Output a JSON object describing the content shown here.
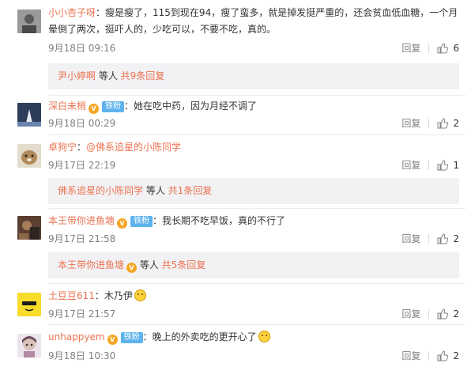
{
  "comments": [
    {
      "username": "小小杏子呀",
      "text": "瘦是瘦了，115到现在94，瘦了蛮多，就是掉发挺严重的，还会贫血低血糖，一个月晕倒了两次，挺吓人的，少吃可以，不要不吃，真的。",
      "date": "9月18日 09:16",
      "reply_label": "回复",
      "likes": "6",
      "avatar_color": "#8a8a8a",
      "sub": {
        "name": "尹小婷啊",
        "mid": " 等人 ",
        "count": "共9条回复"
      }
    },
    {
      "username": "深白未梢",
      "fan_badge": "铁粉",
      "text": "她在吃中药，因为月经不调了",
      "date": "9月18日 00:29",
      "reply_label": "回复",
      "likes": "2",
      "avatar_color": "#3a4a6a"
    },
    {
      "username": "卓狗宁",
      "mention": "@佛系追星的小陈同学",
      "date": "9月17日 22:19",
      "reply_label": "回复",
      "likes": "1",
      "avatar_color": "#c9b08a",
      "sub": {
        "name": "佛系追星的小陈同学",
        "mid": " 等人 ",
        "count": "共1条回复"
      }
    },
    {
      "username": "本王带你进鱼塘",
      "fan_badge": "铁粉",
      "text": "我长期不吃早饭，真的不行了",
      "date": "9月17日 21:58",
      "reply_label": "回复",
      "likes": "2",
      "avatar_color": "#6b4a3a",
      "sub": {
        "name": "本王带你进鱼塘",
        "mid": " 等人 ",
        "count": "共5条回复"
      }
    },
    {
      "username": "土豆豆611",
      "text": "木乃伊",
      "date": "9月17日 21:57",
      "reply_label": "回复",
      "likes": "2",
      "avatar_color": "#f2d21a"
    },
    {
      "username": "unhappyem",
      "fan_badge": "铁粉",
      "text": "晚上的外卖吃的更开心了",
      "date": "9月18日 10:30",
      "reply_label": "回复",
      "likes": "2",
      "avatar_color": "#c7a0b8"
    }
  ],
  "colors": {
    "link": "#eb7350",
    "meta": "#808080",
    "sub_bg": "#f2f2f5",
    "fan_badge": "#5db3eb"
  },
  "icons": {
    "like": "thumbs-up-icon",
    "vip": "vip-badge-icon",
    "emoji": "emoji-icon"
  }
}
